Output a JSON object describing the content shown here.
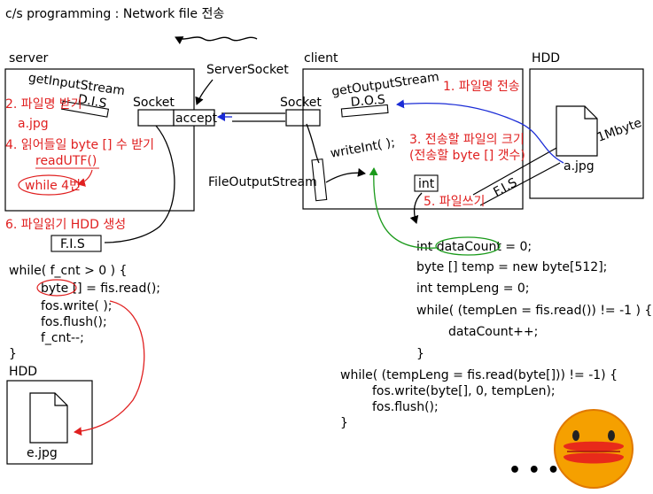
{
  "title": "c/s programming : Network file 전송",
  "boxes": {
    "server": "server",
    "client": "client",
    "hdd_top": "HDD",
    "hdd_bottom": "HDD"
  },
  "labels": {
    "server_socket": "ServerSocket",
    "socket_server": "Socket",
    "accept": "accept",
    "socket_client": "Socket",
    "get_input_stream": "getInputStream",
    "dis": "D.I.S",
    "get_output_stream": "getOutputStream",
    "dos": "D.O.S",
    "write_int": "writeInt( );",
    "file_output_stream": "FileOutputStream",
    "int_box": "int",
    "fis_client": "F.I.S",
    "fis_server": "F.I.S",
    "one_mbyte": "1Mbyte",
    "file_a": "a.jpg",
    "file_e": "e.jpg"
  },
  "red_notes": {
    "step1": "1. 파일명 전송",
    "step2": "2. 파일명 받기",
    "a_jpg": "a.jpg",
    "step4": "4. 읽어들일 byte [] 수 받기",
    "read_utf": "readUTF()",
    "while4": "while 4번",
    "step3_line1": "3. 전송할 파일의 크기",
    "step3_line2": "(전송할 byte [] 갯수)",
    "step5": "5. 파일쓰기",
    "step6": "6. 파일읽기 HDD 생성"
  },
  "client_code": [
    "int dataCount = 0;",
    "byte [] temp = new byte[512];",
    "int tempLeng = 0;",
    "while( (tempLen = fis.read()) != -1 ) {",
    "dataCount++;",
    "}"
  ],
  "client_code2": [
    "while( (tempLeng = fis.read(byte[])) != -1) {",
    "fos.write(byte[], 0, tempLen);",
    "fos.flush();",
    "}"
  ],
  "server_code": [
    "while( f_cnt > 0 ) {",
    "byte [] = fis.read();",
    "fos.write( );",
    "fos.flush();",
    "f_cnt--;",
    "}"
  ],
  "ellipsis": "• • •",
  "colors": {
    "red": "#e02020",
    "blue": "#1a2bd6",
    "green": "#1a9a1a",
    "black": "#000000",
    "face": "#f5a000"
  }
}
